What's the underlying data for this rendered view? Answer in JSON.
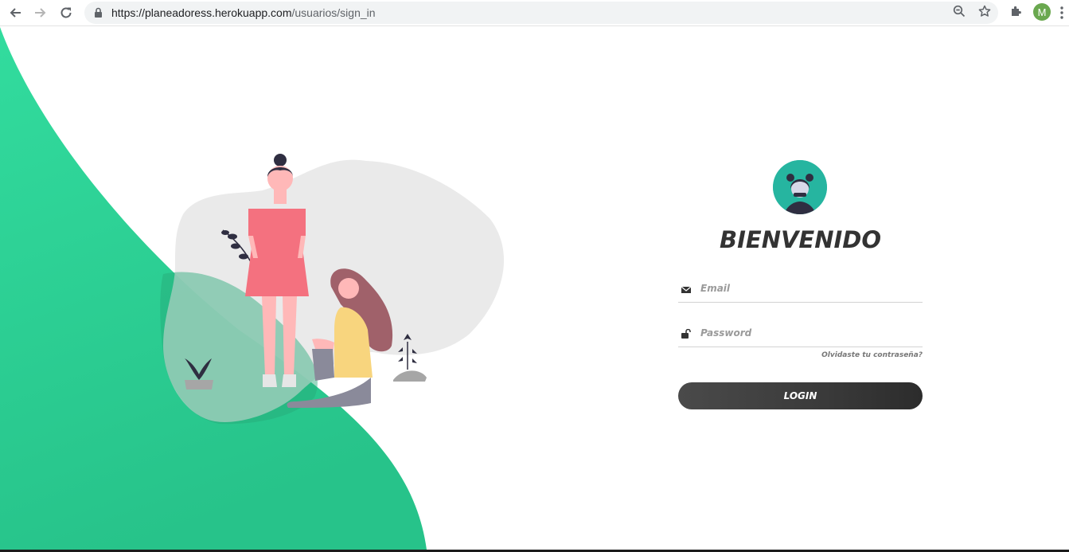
{
  "browser": {
    "url_host": "https://planeadoress.herokuapp.com",
    "url_path": "/usuarios/sign_in",
    "profile_initial": "M",
    "icons": [
      "back-arrow-icon",
      "forward-arrow-icon",
      "reload-icon",
      "lock-icon",
      "zoom-icon",
      "star-icon",
      "extensions-icon",
      "kebab-menu-icon"
    ]
  },
  "login": {
    "title": "BIENVENIDO",
    "email_placeholder": "Email",
    "password_placeholder": "Password",
    "forgot_label": "Olvidaste tu contraseña?",
    "button_label": "LOGIN"
  },
  "colors": {
    "accent_green": "#2fd59a",
    "button_dark": "#3a3a3a",
    "avatar_teal": "#26b5a0"
  }
}
